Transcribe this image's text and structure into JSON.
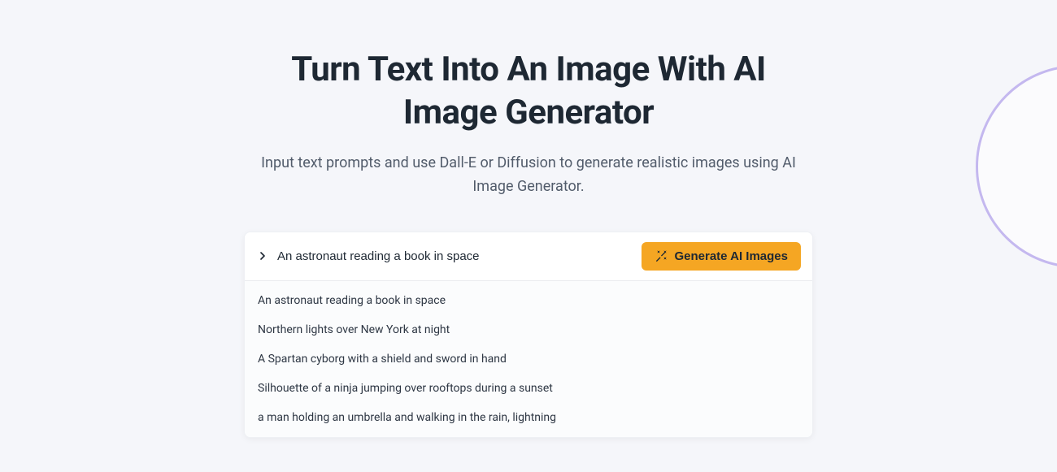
{
  "hero": {
    "title": "Turn Text Into An Image With AI Image Generator",
    "subtitle": "Input text prompts and use Dall-E or Diffusion to generate realistic images using AI Image Generator."
  },
  "prompt": {
    "value": "An astronaut reading a book in space"
  },
  "generate": {
    "label": "Generate AI Images"
  },
  "suggestions": [
    "An astronaut reading a book in space",
    "Northern lights over New York at night",
    "A Spartan cyborg with a shield and sword in hand",
    "Silhouette of a ninja jumping over rooftops during a sunset",
    "a man holding an umbrella and walking in the rain, lightning"
  ]
}
